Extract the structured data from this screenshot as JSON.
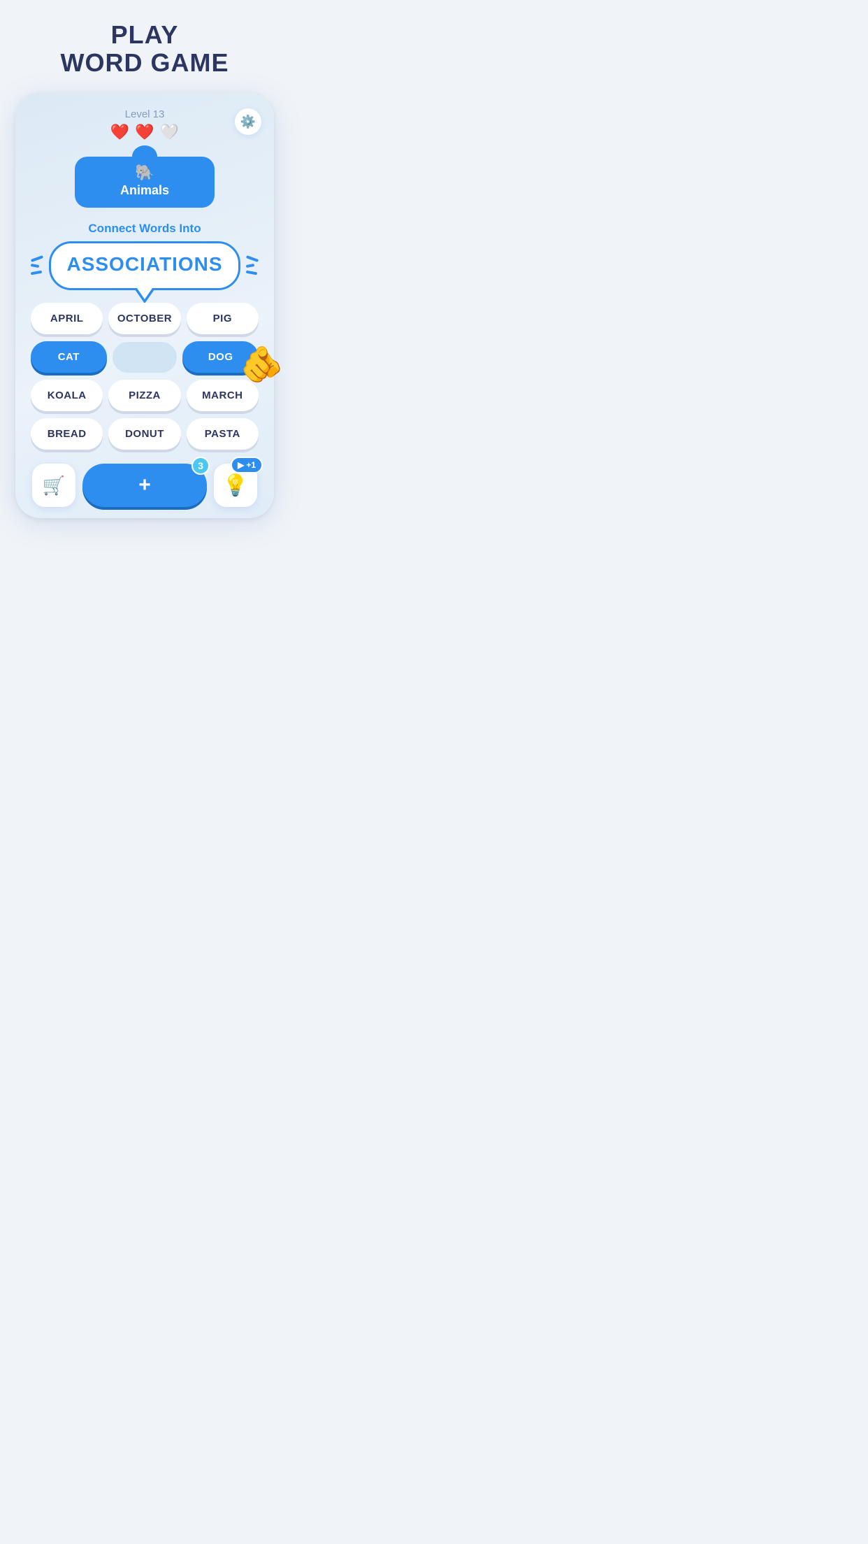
{
  "page": {
    "title_line1": "PLAY",
    "title_line2": "WORD GAME"
  },
  "game": {
    "level_label": "Level 13",
    "hearts": [
      {
        "type": "filled"
      },
      {
        "type": "filled"
      },
      {
        "type": "empty"
      }
    ],
    "category": {
      "icon": "🐘",
      "label": "Animals"
    },
    "subtitle": "Connect Words Into",
    "associations_word": "ASSOCIATIONS",
    "words": [
      [
        {
          "label": "APRIL",
          "selected": false
        },
        {
          "label": "OCTOBER",
          "selected": false
        },
        {
          "label": "PIG",
          "selected": false
        }
      ],
      [
        {
          "label": "CAT",
          "selected": true
        },
        {
          "label": "",
          "selected": false,
          "hidden": true
        },
        {
          "label": "DOG",
          "selected": true
        }
      ],
      [
        {
          "label": "KOALA",
          "selected": false
        },
        {
          "label": "PIZZA",
          "selected": false
        },
        {
          "label": "MARCH",
          "selected": false
        }
      ],
      [
        {
          "label": "BREAD",
          "selected": false
        },
        {
          "label": "DONUT",
          "selected": false
        },
        {
          "label": "PASTA",
          "selected": false
        }
      ]
    ],
    "bottom_bar": {
      "shop_icon": "🛒",
      "add_label": "+",
      "add_badge": "3",
      "hint_icon": "💡",
      "hint_badge": "▶ +1"
    }
  }
}
